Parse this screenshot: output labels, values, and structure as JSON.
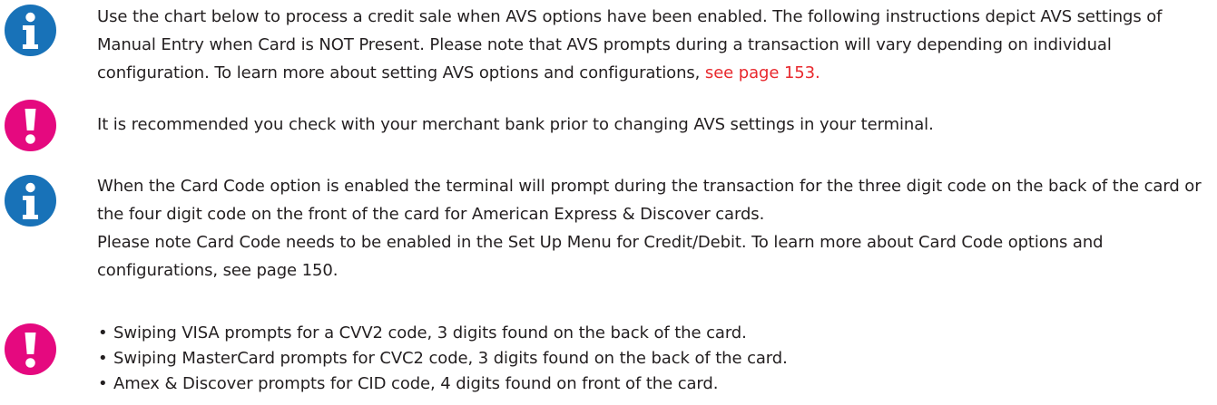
{
  "notes": [
    {
      "icon": "info-icon",
      "color": "#1872b8",
      "text": "Use the chart below to process a credit sale when AVS options have been enabled.  The following instructions depict AVS settings of Manual Entry when Card is NOT Present.  Please note that AVS prompts during a transaction will vary depending on individual configuration.  To learn more about setting AVS options and configurations, ",
      "link_text": "see page 153."
    },
    {
      "icon": "exclamation-icon",
      "color": "#e5097f",
      "text": "It is recommended you check with your merchant bank prior to changing AVS settings in your terminal."
    },
    {
      "icon": "info-icon",
      "color": "#1872b8",
      "text": "When the Card Code option is enabled the terminal will prompt during the transaction for the three digit code on the back of the card or the four digit code on the front of the card for American Express & Discover cards.",
      "text2": "Please note Card Code needs to be enabled in the Set Up Menu for Credit/Debit.  To learn more about Card Code options and configurations, see page 150."
    },
    {
      "icon": "exclamation-icon",
      "color": "#e5097f",
      "bullets": [
        "Swiping VISA prompts for a CVV2 code, 3 digits found on the back of the card.",
        "Swiping MasterCard prompts for CVC2 code, 3 digits found on the back of the card.",
        "Amex & Discover prompts for CID code, 4 digits found on front of the card."
      ]
    }
  ]
}
